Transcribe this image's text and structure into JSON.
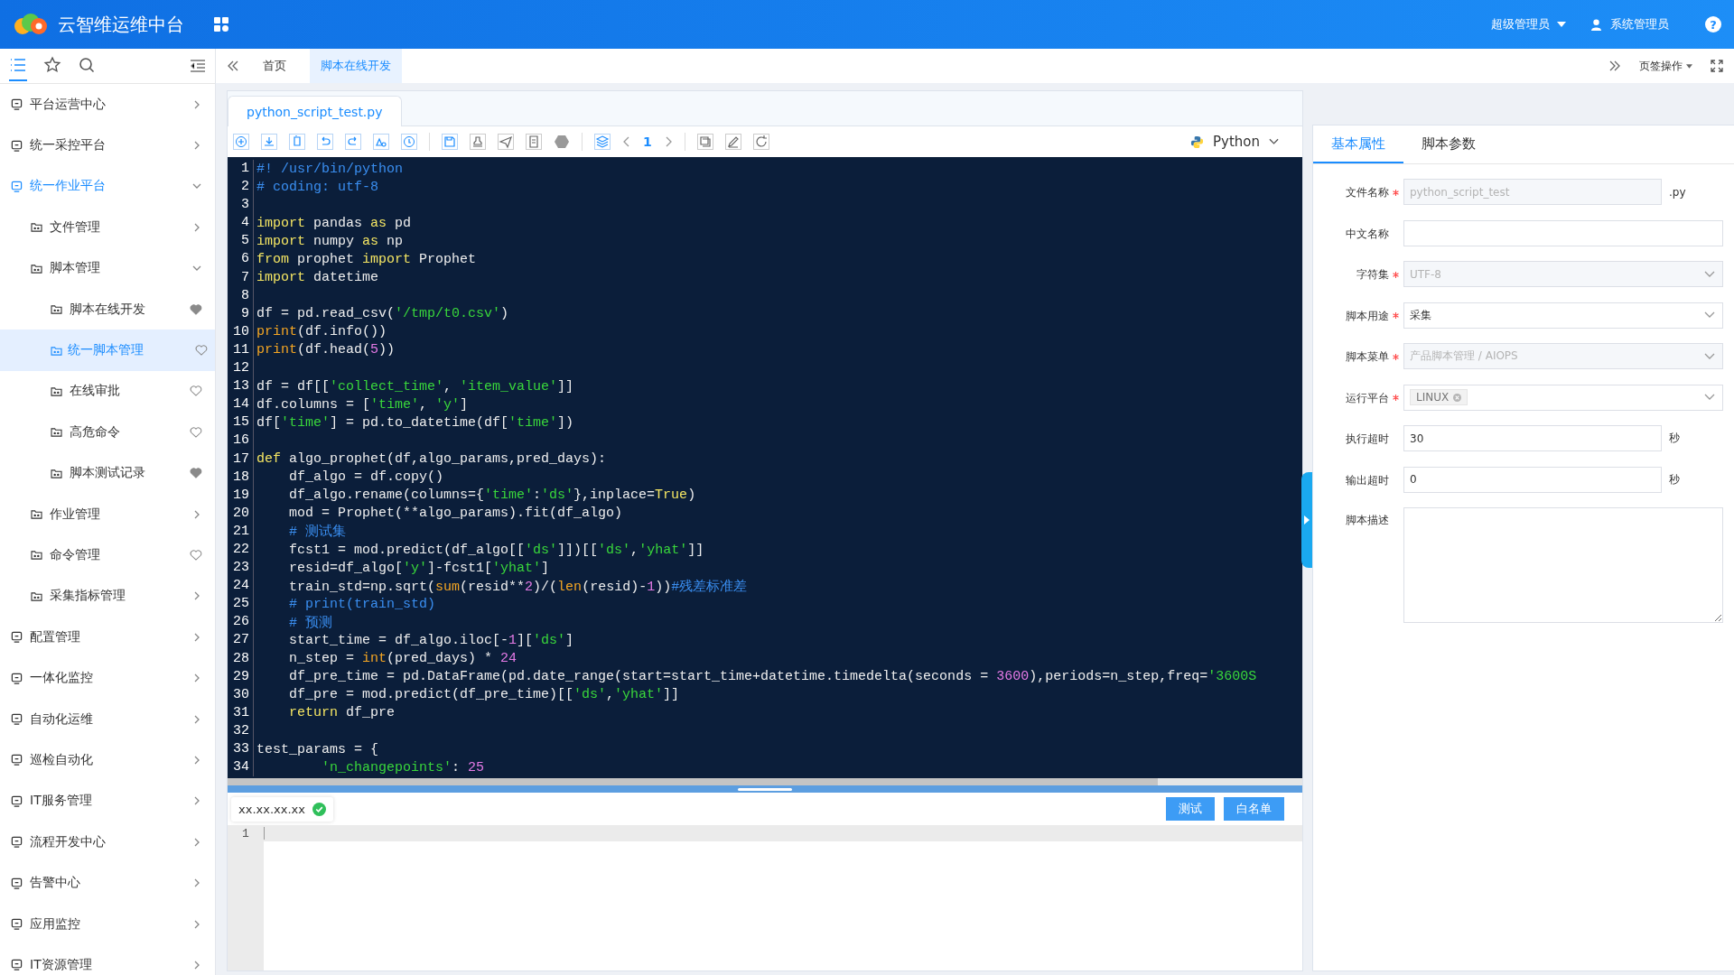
{
  "header": {
    "title": "云智维运维中台",
    "role": "超级管理员",
    "user": "系统管理员",
    "help": "?"
  },
  "tabs_bar": {
    "tabs": [
      {
        "label": "首页",
        "selected": false
      },
      {
        "label": "脚本在线开发",
        "selected": true
      }
    ],
    "actions": "页签操作"
  },
  "sidebar": {
    "icon_tabs": [
      {
        "selected": true
      },
      {
        "selected": false
      },
      {
        "selected": false
      }
    ],
    "items": [
      {
        "label": "平台运营中心",
        "expanded": false,
        "selected": false
      },
      {
        "label": "统一采控平台",
        "expanded": false,
        "selected": false
      },
      {
        "label": "统一作业平台",
        "expanded": true,
        "selected": false,
        "children": [
          {
            "label": "文件管理",
            "expanded": false,
            "selected": false
          },
          {
            "label": "脚本管理",
            "expanded": true,
            "selected": false,
            "children": [
              {
                "label": "脚本在线开发",
                "favorite": true,
                "selected": false
              },
              {
                "label": "统一脚本管理",
                "favorite": false,
                "selected": true
              },
              {
                "label": "在线审批",
                "favorite": false,
                "selected": false
              },
              {
                "label": "高危命令",
                "favorite": false,
                "selected": false
              },
              {
                "label": "脚本测试记录",
                "favorite": true,
                "selected": false
              }
            ]
          },
          {
            "label": "作业管理",
            "expanded": false,
            "selected": false
          },
          {
            "label": "命令管理",
            "favorite": false,
            "selected": false
          },
          {
            "label": "采集指标管理",
            "expanded": false,
            "selected": false
          }
        ]
      },
      {
        "label": "配置管理",
        "expanded": false,
        "selected": false
      },
      {
        "label": "一体化监控",
        "expanded": false,
        "selected": false
      },
      {
        "label": "自动化运维",
        "expanded": false,
        "selected": false
      },
      {
        "label": "巡检自动化",
        "expanded": false,
        "selected": false
      },
      {
        "label": "IT服务管理",
        "expanded": false,
        "selected": false
      },
      {
        "label": "流程开发中心",
        "expanded": false,
        "selected": false
      },
      {
        "label": "告警中心",
        "expanded": false,
        "selected": false
      },
      {
        "label": "应用监控",
        "expanded": false,
        "selected": false
      },
      {
        "label": "IT资源管理",
        "expanded": false,
        "selected": false
      }
    ]
  },
  "editor": {
    "file_tab": "python_script_test.py",
    "page": "1",
    "language": "Python",
    "lines": [
      {
        "num": "1",
        "tokens": [
          {
            "text": "#! /usr/bin/python",
            "kind": "comment"
          }
        ]
      },
      {
        "num": "2",
        "tokens": [
          {
            "text": "# coding: utf-8",
            "kind": "comment"
          }
        ]
      },
      {
        "num": "3"
      },
      {
        "num": "4",
        "tokens": [
          {
            "text": "import",
            "kind": "keyword"
          },
          {
            "text": " pandas ",
            "kind": "plain"
          },
          {
            "text": "as",
            "kind": "keyword"
          },
          {
            "text": " pd",
            "kind": "plain"
          }
        ]
      },
      {
        "num": "5",
        "tokens": [
          {
            "text": "import",
            "kind": "keyword"
          },
          {
            "text": " numpy ",
            "kind": "plain"
          },
          {
            "text": "as",
            "kind": "keyword"
          },
          {
            "text": " np",
            "kind": "plain"
          }
        ]
      },
      {
        "num": "6",
        "tokens": [
          {
            "text": "from",
            "kind": "keyword"
          },
          {
            "text": " prophet ",
            "kind": "plain"
          },
          {
            "text": "import",
            "kind": "keyword"
          },
          {
            "text": " Prophet",
            "kind": "plain"
          }
        ]
      },
      {
        "num": "7",
        "tokens": [
          {
            "text": "import",
            "kind": "keyword"
          },
          {
            "text": " datetime",
            "kind": "plain"
          }
        ]
      },
      {
        "num": "8"
      },
      {
        "num": "9",
        "tokens": [
          {
            "text": "df = pd.read_csv(",
            "kind": "plain"
          },
          {
            "text": "'/tmp/t0.csv'",
            "kind": "string"
          },
          {
            "text": ")",
            "kind": "plain"
          }
        ]
      },
      {
        "num": "10",
        "tokens": [
          {
            "text": "print",
            "kind": "builtin"
          },
          {
            "text": "(df.info())",
            "kind": "plain"
          }
        ]
      },
      {
        "num": "11",
        "tokens": [
          {
            "text": "print",
            "kind": "builtin"
          },
          {
            "text": "(df.head(",
            "kind": "plain"
          },
          {
            "text": "5",
            "kind": "number"
          },
          {
            "text": "))",
            "kind": "plain"
          }
        ]
      },
      {
        "num": "12"
      },
      {
        "num": "13",
        "tokens": [
          {
            "text": "df = df[[",
            "kind": "plain"
          },
          {
            "text": "'collect_time'",
            "kind": "string"
          },
          {
            "text": ", ",
            "kind": "plain"
          },
          {
            "text": "'item_value'",
            "kind": "string"
          },
          {
            "text": "]]",
            "kind": "plain"
          }
        ]
      },
      {
        "num": "14",
        "tokens": [
          {
            "text": "df.columns = [",
            "kind": "plain"
          },
          {
            "text": "'time'",
            "kind": "string"
          },
          {
            "text": ", ",
            "kind": "plain"
          },
          {
            "text": "'y'",
            "kind": "string"
          },
          {
            "text": "]",
            "kind": "plain"
          }
        ]
      },
      {
        "num": "15",
        "tokens": [
          {
            "text": "df[",
            "kind": "plain"
          },
          {
            "text": "'time'",
            "kind": "string"
          },
          {
            "text": "] = pd.to_datetime(df[",
            "kind": "plain"
          },
          {
            "text": "'time'",
            "kind": "string"
          },
          {
            "text": "])",
            "kind": "plain"
          }
        ]
      },
      {
        "num": "16"
      },
      {
        "num": "17",
        "tokens": [
          {
            "text": "def",
            "kind": "keyword"
          },
          {
            "text": " algo_prophet(df,algo_params,pred_days):",
            "kind": "plain"
          }
        ]
      },
      {
        "num": "18",
        "tokens": [
          {
            "text": "    df_algo = df.copy()",
            "kind": "plain"
          }
        ]
      },
      {
        "num": "19",
        "tokens": [
          {
            "text": "    df_algo.rename(columns={",
            "kind": "plain"
          },
          {
            "text": "'time'",
            "kind": "string"
          },
          {
            "text": ":",
            "kind": "plain"
          },
          {
            "text": "'ds'",
            "kind": "string"
          },
          {
            "text": "},inplace=",
            "kind": "plain"
          },
          {
            "text": "True",
            "kind": "keyword"
          },
          {
            "text": ")",
            "kind": "plain"
          }
        ]
      },
      {
        "num": "20",
        "tokens": [
          {
            "text": "    mod = Prophet(**algo_params).fit(df_algo)",
            "kind": "plain"
          }
        ]
      },
      {
        "num": "21",
        "tokens": [
          {
            "text": "    # 测试集",
            "kind": "comment"
          }
        ]
      },
      {
        "num": "22",
        "tokens": [
          {
            "text": "    fcst1 = mod.predict(df_algo[[",
            "kind": "plain"
          },
          {
            "text": "'ds'",
            "kind": "string"
          },
          {
            "text": "]])[[",
            "kind": "plain"
          },
          {
            "text": "'ds'",
            "kind": "string"
          },
          {
            "text": ",",
            "kind": "plain"
          },
          {
            "text": "'yhat'",
            "kind": "string"
          },
          {
            "text": "]]",
            "kind": "plain"
          }
        ]
      },
      {
        "num": "23",
        "tokens": [
          {
            "text": "    resid=df_algo[",
            "kind": "plain"
          },
          {
            "text": "'y'",
            "kind": "string"
          },
          {
            "text": "]-fcst1[",
            "kind": "plain"
          },
          {
            "text": "'yhat'",
            "kind": "string"
          },
          {
            "text": "]",
            "kind": "plain"
          }
        ]
      },
      {
        "num": "24",
        "tokens": [
          {
            "text": "    train_std=np.sqrt(",
            "kind": "plain"
          },
          {
            "text": "sum",
            "kind": "builtin"
          },
          {
            "text": "(resid**",
            "kind": "plain"
          },
          {
            "text": "2",
            "kind": "number"
          },
          {
            "text": ")/(",
            "kind": "plain"
          },
          {
            "text": "len",
            "kind": "builtin"
          },
          {
            "text": "(resid)-",
            "kind": "plain"
          },
          {
            "text": "1",
            "kind": "number"
          },
          {
            "text": "))",
            "kind": "plain"
          },
          {
            "text": "#残差标准差",
            "kind": "comment"
          }
        ]
      },
      {
        "num": "25",
        "tokens": [
          {
            "text": "    # print(train_std)",
            "kind": "comment"
          }
        ]
      },
      {
        "num": "26",
        "tokens": [
          {
            "text": "    # 预测",
            "kind": "comment"
          }
        ]
      },
      {
        "num": "27",
        "tokens": [
          {
            "text": "    start_time = df_algo.iloc[-",
            "kind": "plain"
          },
          {
            "text": "1",
            "kind": "number"
          },
          {
            "text": "][",
            "kind": "plain"
          },
          {
            "text": "'ds'",
            "kind": "string"
          },
          {
            "text": "]",
            "kind": "plain"
          }
        ]
      },
      {
        "num": "28",
        "tokens": [
          {
            "text": "    n_step = ",
            "kind": "plain"
          },
          {
            "text": "int",
            "kind": "builtin"
          },
          {
            "text": "(pred_days) * ",
            "kind": "plain"
          },
          {
            "text": "24",
            "kind": "number"
          }
        ]
      },
      {
        "num": "29",
        "tokens": [
          {
            "text": "    df_pre_time = pd.DataFrame(pd.date_range(start=start_time+datetime.timedelta(seconds = ",
            "kind": "plain"
          },
          {
            "text": "3600",
            "kind": "number"
          },
          {
            "text": "),periods=n_step,freq=",
            "kind": "plain"
          },
          {
            "text": "'3600S",
            "kind": "string"
          }
        ]
      },
      {
        "num": "30",
        "tokens": [
          {
            "text": "    df_pre = mod.predict(df_pre_time)[[",
            "kind": "plain"
          },
          {
            "text": "'ds'",
            "kind": "string"
          },
          {
            "text": ",",
            "kind": "plain"
          },
          {
            "text": "'yhat'",
            "kind": "string"
          },
          {
            "text": "]]",
            "kind": "plain"
          }
        ]
      },
      {
        "num": "31",
        "tokens": [
          {
            "text": "    return",
            "kind": "keyword"
          },
          {
            "text": " df_pre",
            "kind": "plain"
          }
        ]
      },
      {
        "num": "32"
      },
      {
        "num": "33",
        "tokens": [
          {
            "text": "test_params = {",
            "kind": "plain"
          }
        ]
      },
      {
        "num": "34",
        "tokens": [
          {
            "text": "        'n_changepoints'",
            "kind": "string"
          },
          {
            "text": ": ",
            "kind": "plain"
          },
          {
            "text": "25",
            "kind": "number"
          }
        ]
      }
    ]
  },
  "console": {
    "host": "xx.xx.xx.xx",
    "host_ok": true,
    "buttons": [
      "测试",
      "白名单"
    ],
    "lines": [
      "1"
    ]
  },
  "properties": {
    "tabs": [
      {
        "label": "基本属性",
        "selected": true
      },
      {
        "label": "脚本参数",
        "selected": false
      }
    ],
    "fields": [
      {
        "label": "文件名称",
        "required": true,
        "kind": "text",
        "value": "python_script_test",
        "disabled": true,
        "suffix": ".py"
      },
      {
        "label": "中文名称",
        "required": false,
        "kind": "text"
      },
      {
        "label": "字符集",
        "required": true,
        "kind": "select",
        "value": "UTF-8",
        "disabled": true
      },
      {
        "label": "脚本用途",
        "required": true,
        "kind": "select",
        "value": "采集",
        "disabled": false
      },
      {
        "label": "脚本菜单",
        "required": true,
        "kind": "select",
        "value": "产品脚本管理 / AIOPS",
        "disabled": true
      },
      {
        "label": "运行平台",
        "required": true,
        "kind": "tags",
        "tags": [
          "LINUX"
        ]
      },
      {
        "label": "执行超时",
        "required": false,
        "kind": "text",
        "value": "30",
        "disabled": false,
        "suffix": "秒"
      },
      {
        "label": "输出超时",
        "required": false,
        "kind": "text",
        "value": "0",
        "disabled": false,
        "suffix": "秒"
      },
      {
        "label": "脚本描述",
        "required": false,
        "kind": "textarea"
      }
    ]
  }
}
